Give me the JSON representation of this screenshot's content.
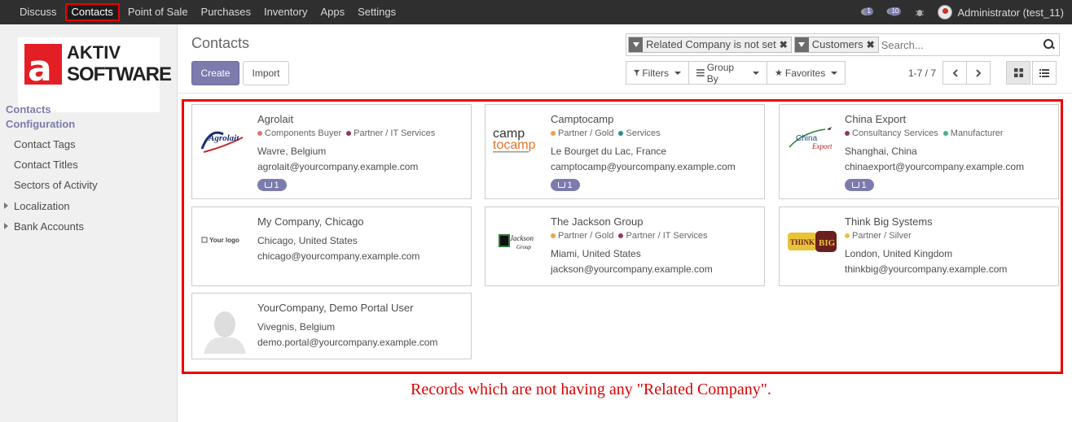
{
  "nav": {
    "items": [
      "Discuss",
      "Contacts",
      "Point of Sale",
      "Purchases",
      "Inventory",
      "Apps",
      "Settings"
    ],
    "active": "Contacts",
    "chat_count": "1",
    "activity_count": "10",
    "user_label": "Administrator (test_11)"
  },
  "sidebar": {
    "logo_line1": "AKTIV",
    "logo_line2": "SOFTWARE",
    "logo_letter": "a",
    "sections": [
      "Contacts",
      "Configuration"
    ],
    "items": [
      "Contact Tags",
      "Contact Titles",
      "Sectors of Activity",
      "Localization",
      "Bank Accounts"
    ]
  },
  "page": {
    "title": "Contacts",
    "create_label": "Create",
    "import_label": "Import",
    "facets": [
      "Related Company is not set",
      "Customers"
    ],
    "search_placeholder": "Search...",
    "filters_label": "Filters",
    "groupby_label": "Group By",
    "favorites_label": "Favorites",
    "pager": "1-7 / 7"
  },
  "cards": [
    {
      "name": "Agrolait",
      "tags": [
        {
          "label": "Components Buyer",
          "color": "#e57373"
        },
        {
          "label": "Partner / IT Services",
          "color": "#8e3a59"
        }
      ],
      "address": "Wavre, Belgium",
      "email": "agrolait@yourcompany.example.com",
      "orders": "1",
      "logo": "Agrolait"
    },
    {
      "name": "Camptocamp",
      "tags": [
        {
          "label": "Partner / Gold",
          "color": "#f0a04b"
        },
        {
          "label": "Services",
          "color": "#2e8b8b"
        }
      ],
      "address": "Le Bourget du Lac, France",
      "email": "camptocamp@yourcompany.example.com",
      "orders": "1",
      "logo": "camptocamp"
    },
    {
      "name": "China Export",
      "tags": [
        {
          "label": "Consultancy Services",
          "color": "#8e3a59"
        },
        {
          "label": "Manufacturer",
          "color": "#4caf8a"
        }
      ],
      "address": "Shanghai, China",
      "email": "chinaexport@yourcompany.example.com",
      "orders": "1",
      "logo": "China Export"
    },
    {
      "name": "My Company, Chicago",
      "tags": [],
      "address": "Chicago, United States",
      "email": "chicago@yourcompany.example.com",
      "orders": "",
      "logo": "Your logo"
    },
    {
      "name": "The Jackson Group",
      "tags": [
        {
          "label": "Partner / Gold",
          "color": "#f0a04b"
        },
        {
          "label": "Partner / IT Services",
          "color": "#8e3a59"
        }
      ],
      "address": "Miami, United States",
      "email": "jackson@yourcompany.example.com",
      "orders": "",
      "logo": "Jackson Group"
    },
    {
      "name": "Think Big Systems",
      "tags": [
        {
          "label": "Partner / Silver",
          "color": "#e8c33a"
        }
      ],
      "address": "London, United Kingdom",
      "email": "thinkbig@yourcompany.example.com",
      "orders": "",
      "logo": "THINK BIG"
    },
    {
      "name": "YourCompany, Demo Portal User",
      "tags": [],
      "address": "Vivegnis, Belgium",
      "email": "demo.portal@yourcompany.example.com",
      "orders": "",
      "logo": ""
    }
  ],
  "annotation": "Records which are not having any \"Related Company\"."
}
